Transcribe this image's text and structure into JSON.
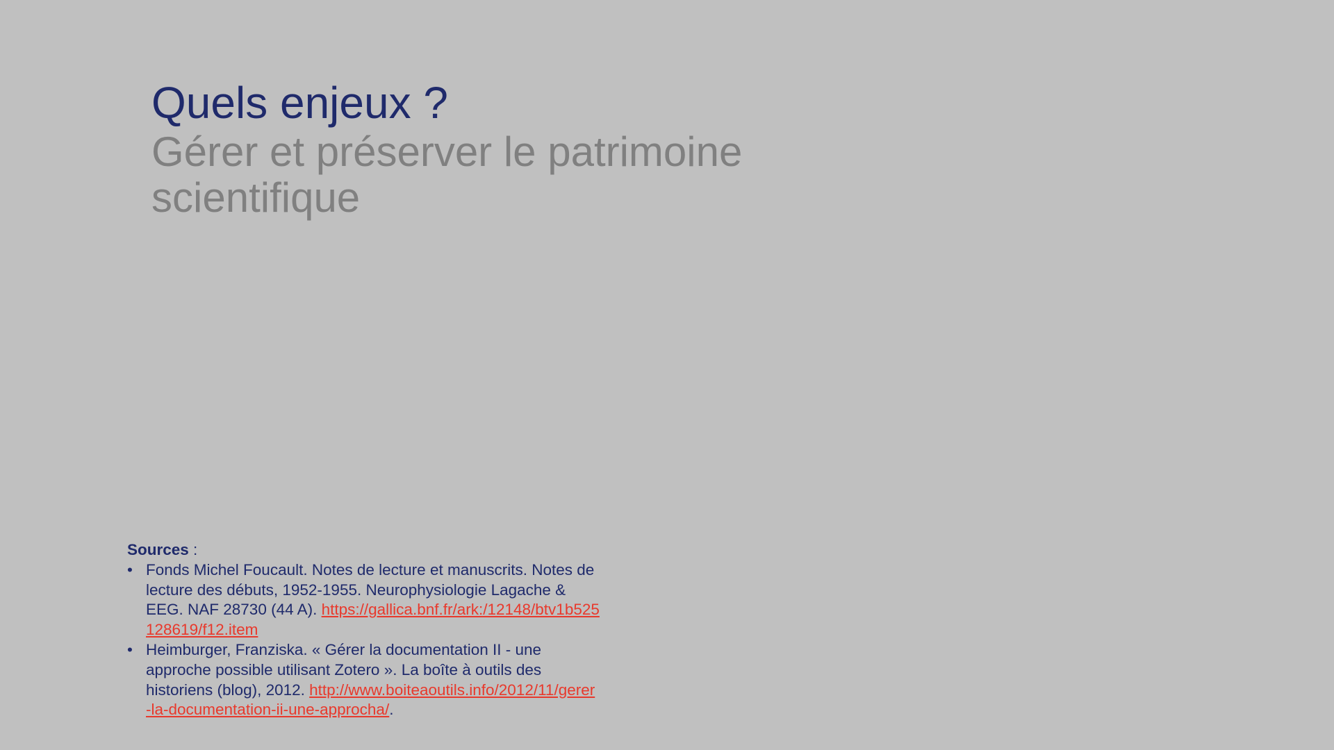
{
  "slide": {
    "title": "Quels enjeux ?",
    "subtitle": "Gérer et préserver le patrimoine scientifique"
  },
  "sources": {
    "heading": "Sources",
    "heading_suffix": " :",
    "bullet": "•",
    "items": [
      {
        "text": "Fonds Michel Foucault. Notes de lecture et manuscrits. Notes de lecture des débuts, 1952-1955. Neurophysiologie Lagache & EEG. NAF 28730 (44 A). ",
        "link": "https://gallica.bnf.fr/ark:/12148/btv1b525128619/f12.item",
        "trailing": ""
      },
      {
        "text": "Heimburger, Franziska. « Gérer la documentation II - une approche possible utilisant Zotero ». La boîte à outils des historiens (blog), 2012. ",
        "link": "http://www.boiteaoutils.info/2012/11/gerer-la-documentation-ii-une-approcha/",
        "trailing": "."
      }
    ]
  },
  "colors": {
    "background": "#c0c0c0",
    "title": "#1f2a6b",
    "subtitle": "#808080",
    "link": "#e8392c"
  }
}
